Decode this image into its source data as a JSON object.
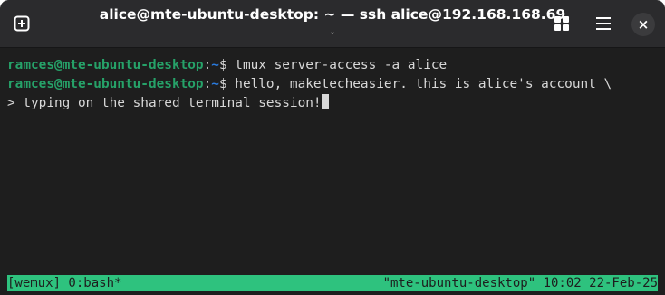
{
  "window": {
    "title": "alice@mte-ubuntu-desktop: ~ — ssh alice@192.168.168.69",
    "title_chevron": "⌄",
    "close_glyph": "×",
    "icons": [
      "new-tab-icon",
      "grid-icon",
      "hamburger-menu-icon",
      "close-icon"
    ]
  },
  "terminal": {
    "lines": [
      {
        "user": "ramces@mte-ubuntu-desktop",
        "sep": ":",
        "path": "~",
        "text": "$ tmux server-access -a alice"
      },
      {
        "user": "ramces@mte-ubuntu-desktop",
        "sep": ":",
        "path": "~",
        "text": "$ hello, maketecheasier. this is alice's account \\"
      },
      {
        "text": "> typing on the shared terminal session!"
      }
    ]
  },
  "statusbar": {
    "left": "[wemux] 0:bash*",
    "right": "\"mte-ubuntu-desktop\" 10:02 22-Feb-25"
  },
  "colors": {
    "titlebar": "#2b2b2d",
    "terminal_bg": "#1e1e1e",
    "prompt_user": "#26a269",
    "prompt_path": "#2a7bde",
    "statusbar": "#2ec27e"
  }
}
